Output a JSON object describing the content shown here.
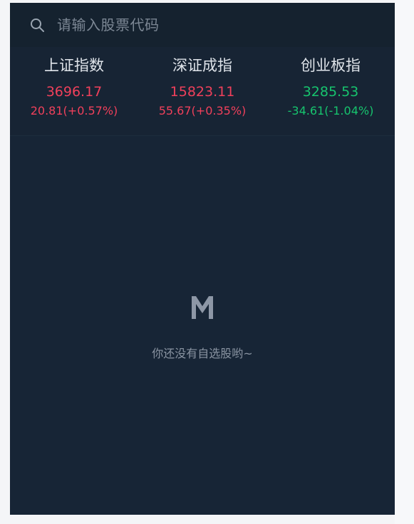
{
  "search": {
    "placeholder": "请输入股票代码",
    "icon": "search-icon"
  },
  "indices": [
    {
      "name": "上证指数",
      "value": "3696.17",
      "change": "20.81(+0.57%)",
      "trend": "up"
    },
    {
      "name": "深证成指",
      "value": "15823.11",
      "change": "55.67(+0.35%)",
      "trend": "up"
    },
    {
      "name": "创业板指",
      "value": "3285.53",
      "change": "-34.61(-1.04%)",
      "trend": "down"
    }
  ],
  "empty_state": {
    "logo": "M",
    "message": "你还没有自选股哟~"
  },
  "colors": {
    "background": "#172536",
    "up": "#f0405b",
    "down": "#17c46e",
    "muted_text": "#8a94a2"
  }
}
